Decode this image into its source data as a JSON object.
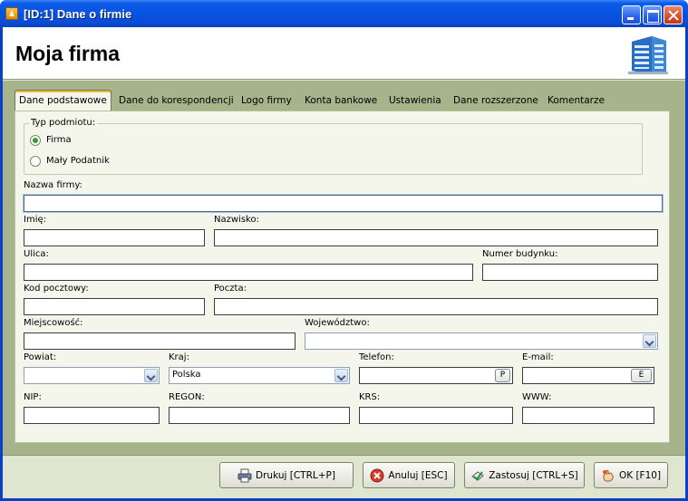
{
  "window": {
    "title": "[ID:1] Dane o firmie"
  },
  "header": {
    "title": "Moja firma"
  },
  "tabs": [
    {
      "label": "Dane podstawowe"
    },
    {
      "label": "Dane do korespondencji"
    },
    {
      "label": "Logo firmy"
    },
    {
      "label": "Konta bankowe"
    },
    {
      "label": "Ustawienia"
    },
    {
      "label": "Dane rozszerzone"
    },
    {
      "label": "Komentarze"
    }
  ],
  "entity_type": {
    "legend": "Typ podmiotu:",
    "options": [
      {
        "label": "Firma",
        "checked": true
      },
      {
        "label": "Mały Podatnik",
        "checked": false
      }
    ]
  },
  "form": {
    "company_name": {
      "label": "Nazwa firmy:",
      "value": ""
    },
    "first_name": {
      "label": "Imię:",
      "value": ""
    },
    "last_name": {
      "label": "Nazwisko:",
      "value": ""
    },
    "street": {
      "label": "Ulica:",
      "value": ""
    },
    "building_number": {
      "label": "Numer budynku:",
      "value": ""
    },
    "postal_code": {
      "label": "Kod pocztowy:",
      "value": ""
    },
    "post_office": {
      "label": "Poczta:",
      "value": ""
    },
    "city": {
      "label": "Miejscowość:",
      "value": ""
    },
    "voivodeship": {
      "label": "Województwo:",
      "value": ""
    },
    "county": {
      "label": "Powiat:",
      "value": ""
    },
    "country": {
      "label": "Kraj:",
      "value": "Polska"
    },
    "phone": {
      "label": "Telefon:",
      "value": "",
      "button": "P"
    },
    "email": {
      "label": "E-mail:",
      "value": "",
      "button": "E"
    },
    "nip": {
      "label": "NIP:",
      "value": ""
    },
    "regon": {
      "label": "REGON:",
      "value": ""
    },
    "krs": {
      "label": "KRS:",
      "value": ""
    },
    "www": {
      "label": "WWW:",
      "value": ""
    }
  },
  "buttons": {
    "print": "Drukuj [CTRL+P]",
    "cancel": "Anuluj [ESC]",
    "apply": "Zastosuj [CTRL+S]",
    "ok": "OK [F10]"
  },
  "icons": {
    "app": "app-icon",
    "header": "building-icon",
    "print": "printer-icon",
    "cancel": "cancel-icon",
    "apply": "apply-icon",
    "ok": "ok-hand-icon"
  },
  "colors": {
    "titlebar": "#0853e2",
    "tab_area": "#a7b48b",
    "page": "#f4f6ec",
    "radio_checked": "#33a02c"
  }
}
